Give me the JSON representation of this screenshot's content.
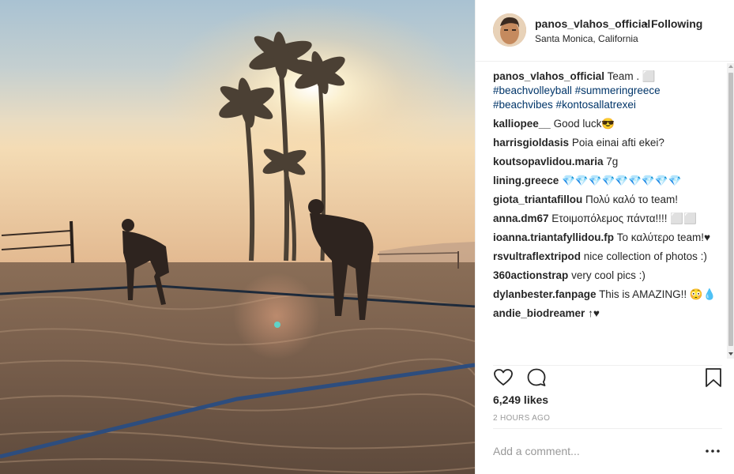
{
  "post": {
    "username": "panos_vlahos_official",
    "separator": "•",
    "follow_status": "Following",
    "location": "Santa Monica, California"
  },
  "comments": [
    {
      "user": "panos_vlahos_official",
      "text": "Team . ⬜",
      "hashtags": "#beachvolleyball #summeringreece #beachvibes #kontosallatrexei"
    },
    {
      "user": "kalliopee__",
      "text": "Good luck😎"
    },
    {
      "user": "harrisgioldasis",
      "text": "Poia einai afti ekei?"
    },
    {
      "user": "koutsopavlidou.maria",
      "text": "7g"
    },
    {
      "user": "lining.greece",
      "text": "💎💎💎💎💎💎💎💎💎"
    },
    {
      "user": "giota_triantafillou",
      "text": "Πολύ καλό το team!"
    },
    {
      "user": "anna.dm67",
      "text": "Ετοιμοπόλεμος πάντα!!!! ⬜⬜"
    },
    {
      "user": "ioanna.triantafyllidou.fp",
      "text": "Το καλύτερο team!♥"
    },
    {
      "user": "rsvultraflextripod",
      "text": "nice collection of photos :)"
    },
    {
      "user": "360actionstrap",
      "text": "very cool pics :)"
    },
    {
      "user": "dylanbester.fanpage",
      "text": "This is AMAZING!! 😳💧"
    },
    {
      "user": "andie_biodreamer",
      "text": "↑♥"
    }
  ],
  "likes": "6,249 likes",
  "time_ago": "2 HOURS AGO",
  "add_comment": {
    "placeholder": "Add a comment..."
  },
  "icons": {
    "like": "heart-icon",
    "comment": "comment-bubble-icon",
    "save": "bookmark-icon",
    "more": "more-options-icon"
  }
}
